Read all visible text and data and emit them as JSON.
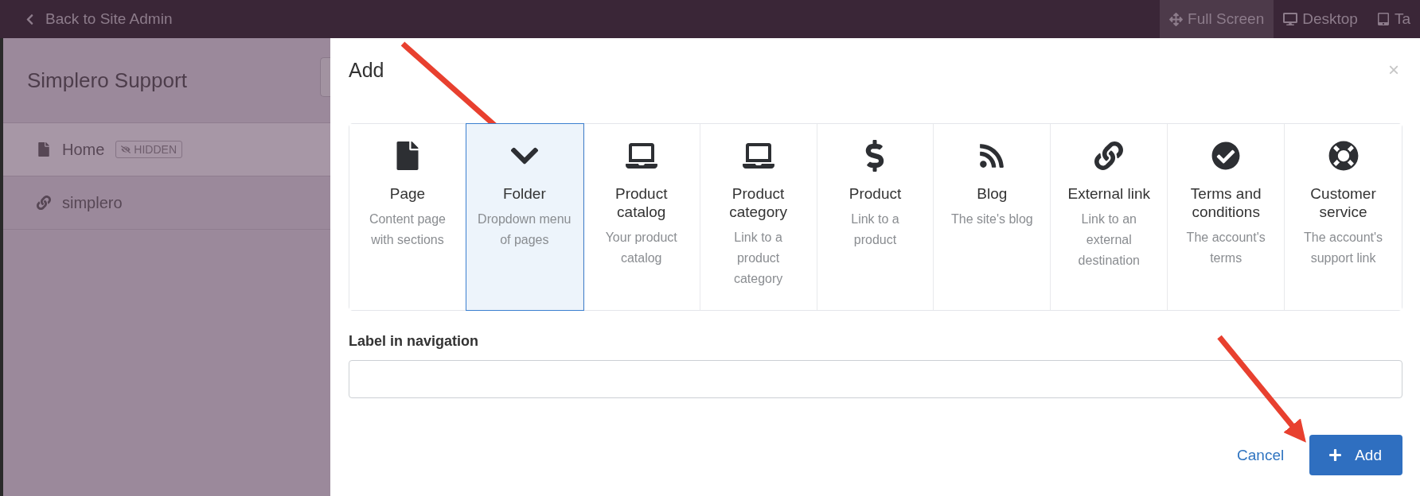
{
  "top_bar": {
    "back_link": "Back to Site Admin",
    "views": [
      {
        "kind": "move",
        "label": "Full Screen",
        "selected": true
      },
      {
        "kind": "desktop",
        "label": "Desktop",
        "selected": false
      },
      {
        "kind": "tablet",
        "label": "Ta",
        "selected": false
      }
    ]
  },
  "sidebar": {
    "title": "Simplero Support",
    "items": [
      {
        "kind": "page",
        "label": "Home",
        "badge": "HIDDEN",
        "selected": true
      },
      {
        "kind": "link",
        "label": "simplero",
        "selected": false
      }
    ]
  },
  "dialog": {
    "title": "Add",
    "close": "×",
    "types": [
      {
        "kind": "page",
        "title": "Page",
        "description": "Content page with sections",
        "selected": false
      },
      {
        "kind": "folder",
        "title": "Folder",
        "description": "Dropdown menu of pages",
        "selected": true
      },
      {
        "kind": "laptop",
        "title": "Product catalog",
        "description": "Your product catalog",
        "selected": false
      },
      {
        "kind": "laptop",
        "title": "Product category",
        "description": "Link to a product category",
        "selected": false
      },
      {
        "kind": "dollar",
        "title": "Product",
        "description": "Link to a product",
        "selected": false
      },
      {
        "kind": "rss",
        "title": "Blog",
        "description": "The site's blog",
        "selected": false
      },
      {
        "kind": "link",
        "title": "External link",
        "description": "Link to an external destination",
        "selected": false
      },
      {
        "kind": "check",
        "title": "Terms and conditions",
        "description": "The account's terms",
        "selected": false
      },
      {
        "kind": "lifebuoy",
        "title": "Customer service",
        "description": "The account's support link",
        "selected": false
      }
    ],
    "label_field": {
      "label": "Label in navigation"
    },
    "cancel": "Cancel",
    "add": "Add"
  }
}
